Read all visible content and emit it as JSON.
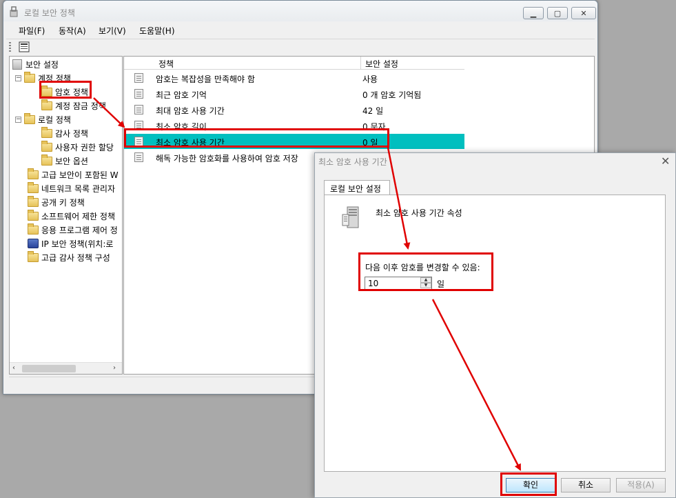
{
  "window": {
    "title": "로컬 보안 정책",
    "menu": [
      "파일(F)",
      "동작(A)",
      "보기(V)",
      "도움말(H)"
    ]
  },
  "tree": {
    "root": "보안 설정",
    "items": [
      {
        "label": "계정 정책",
        "level": 1,
        "expanded": true
      },
      {
        "label": "암호 정책",
        "level": 2
      },
      {
        "label": "계정 잠금 정책",
        "level": 2
      },
      {
        "label": "로컬 정책",
        "level": 1,
        "expanded": true
      },
      {
        "label": "감사 정책",
        "level": 2
      },
      {
        "label": "사용자 권한 할당",
        "level": 2
      },
      {
        "label": "보안 옵션",
        "level": 2
      },
      {
        "label": "고급 보안이 포함된 W",
        "level": 1
      },
      {
        "label": "네트워크 목록 관리자",
        "level": 1
      },
      {
        "label": "공개 키 정책",
        "level": 1
      },
      {
        "label": "소프트웨어 제한 정책",
        "level": 1
      },
      {
        "label": "응용 프로그램 제어 정",
        "level": 1
      },
      {
        "label": "IP 보안 정책(위치:로",
        "level": 1
      },
      {
        "label": "고급 감사 정책 구성",
        "level": 1
      }
    ],
    "scroll_left": "‹",
    "scroll_right": "›"
  },
  "list": {
    "columns": [
      "정책",
      "보안 설정"
    ],
    "rows": [
      {
        "policy": "암호는 복잡성을 만족해야 함",
        "setting": "사용"
      },
      {
        "policy": "최근 암호 기억",
        "setting": "0 개 암호 기억됨"
      },
      {
        "policy": "최대 암호 사용 기간",
        "setting": "42 일"
      },
      {
        "policy": "최소 암호 길이",
        "setting": "0 문자"
      },
      {
        "policy": "최소 암호 사용 기간",
        "setting": "0 일",
        "selected": true
      },
      {
        "policy": "해독 가능한 암호화를 사용하여 암호 저장",
        "setting": ""
      }
    ]
  },
  "dialog": {
    "title": "최소 암호 사용 기간",
    "tab": "로컬 보안 설정",
    "heading": "최소 암호 사용 기간 속성",
    "field_label": "다음 이후 암호를 변경할 수 있음:",
    "value": "10",
    "unit": "일",
    "ok": "확인",
    "cancel": "취소",
    "apply": "적용(A)",
    "close_glyph": "✕"
  },
  "highlight_color": "#e00000",
  "selection_color": "#00bfbf"
}
